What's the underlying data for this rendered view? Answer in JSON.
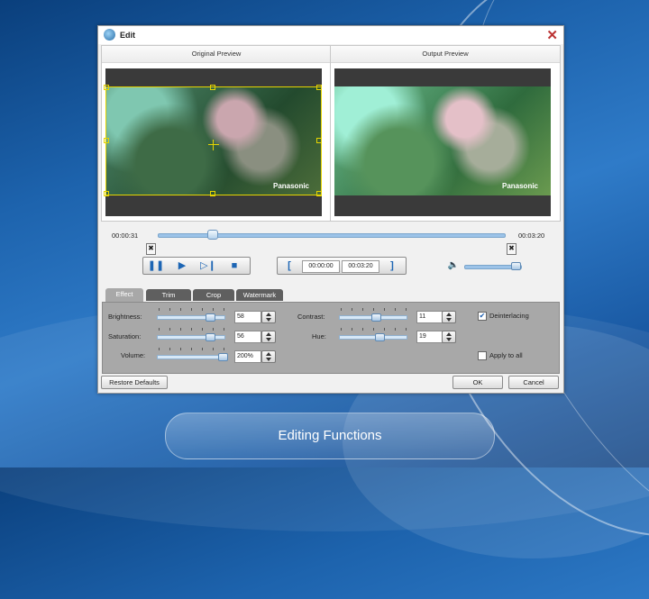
{
  "window": {
    "title": "Edit",
    "close_glyph": "✕"
  },
  "preview": {
    "original_label": "Original Preview",
    "output_label": "Output Preview",
    "watermark": "Panasonic"
  },
  "playback": {
    "current_time": "00:00:31",
    "total_time": "00:03:20",
    "seek_position": 0.155,
    "clip_start": "00:00:00",
    "clip_end": "00:03:20",
    "volume_level": 0.9
  },
  "tabs": [
    {
      "label": "Effect",
      "active": true
    },
    {
      "label": "Trim",
      "active": false
    },
    {
      "label": "Crop",
      "active": false
    },
    {
      "label": "Watermark",
      "active": false
    }
  ],
  "effect": {
    "brightness": {
      "label": "Brightness:",
      "value": "58"
    },
    "saturation": {
      "label": "Saturation:",
      "value": "56"
    },
    "volume": {
      "label": "Volume:",
      "value": "200%"
    },
    "contrast": {
      "label": "Contrast:",
      "value": "11"
    },
    "hue": {
      "label": "Hue:",
      "value": "19"
    },
    "deinterlacing": {
      "label": "Deinterlacing",
      "checked": true
    },
    "apply_all": {
      "label": "Apply to all",
      "checked": false
    }
  },
  "buttons": {
    "restore": "Restore Defaults",
    "ok": "OK",
    "cancel": "Cancel"
  },
  "caption": "Editing Functions",
  "colors": {
    "accent": "#1c65b4",
    "crop_frame": "#e6d400"
  }
}
